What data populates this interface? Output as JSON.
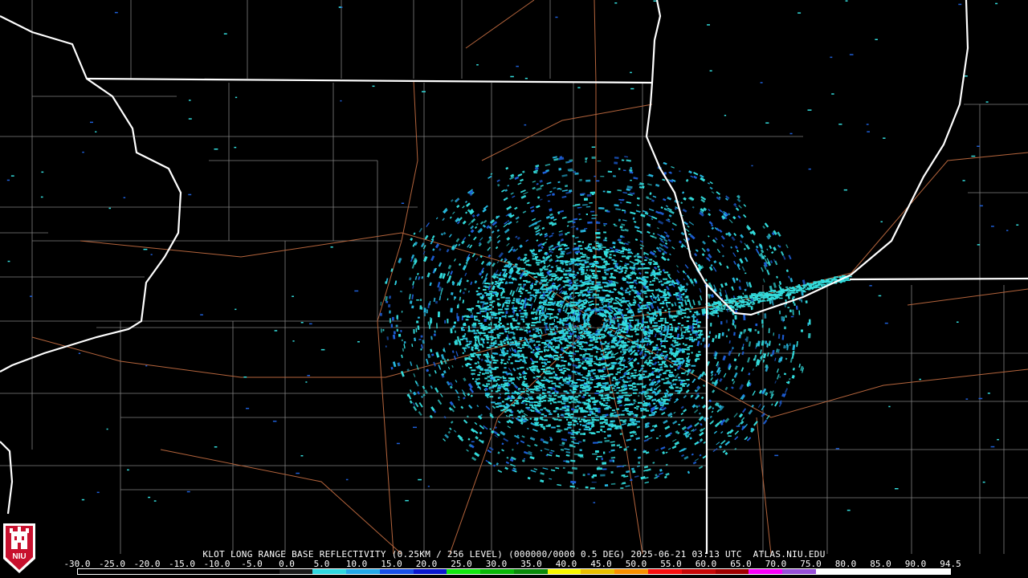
{
  "caption": "KLOT LONG RANGE BASE REFLECTIVITY (0.25KM / 256 LEVEL) (000000/0000 0.5 DEG) 2025-06-21 03:13 UTC  ATLAS.NIU.EDU",
  "logo": {
    "text": "NIU",
    "icon": "niu-castle-logo"
  },
  "colors": {
    "background": "#000000",
    "state_border": "#ffffff",
    "county_border": "#808080",
    "highway": "#b4643c",
    "echo_light": "#33dddd",
    "echo_mid": "#26b8e0",
    "echo_blue": "#1e5fd8"
  },
  "legend": {
    "labels": [
      "-30.0",
      "-25.0",
      "-20.0",
      "-15.0",
      "-10.0",
      "-5.0",
      "0.0",
      "5.0",
      "10.0",
      "15.0",
      "20.0",
      "25.0",
      "30.0",
      "35.0",
      "40.0",
      "45.0",
      "50.0",
      "55.0",
      "60.0",
      "65.0",
      "70.0",
      "75.0",
      "80.0",
      "85.0",
      "90.0",
      "94.5"
    ],
    "colors": [
      "#000000",
      "#000000",
      "#000000",
      "#000000",
      "#000000",
      "#000000",
      "#1a1a1a",
      "#30d8e0",
      "#24a8e8",
      "#1850e8",
      "#0a18d0",
      "#10e810",
      "#08b808",
      "#0a8a0a",
      "#f8f800",
      "#e8c000",
      "#f89000",
      "#f81010",
      "#c80808",
      "#a00000",
      "#f800f8",
      "#9850d8",
      "#ffffff",
      "#ffffff",
      "#ffffff",
      "#ffffff"
    ]
  }
}
